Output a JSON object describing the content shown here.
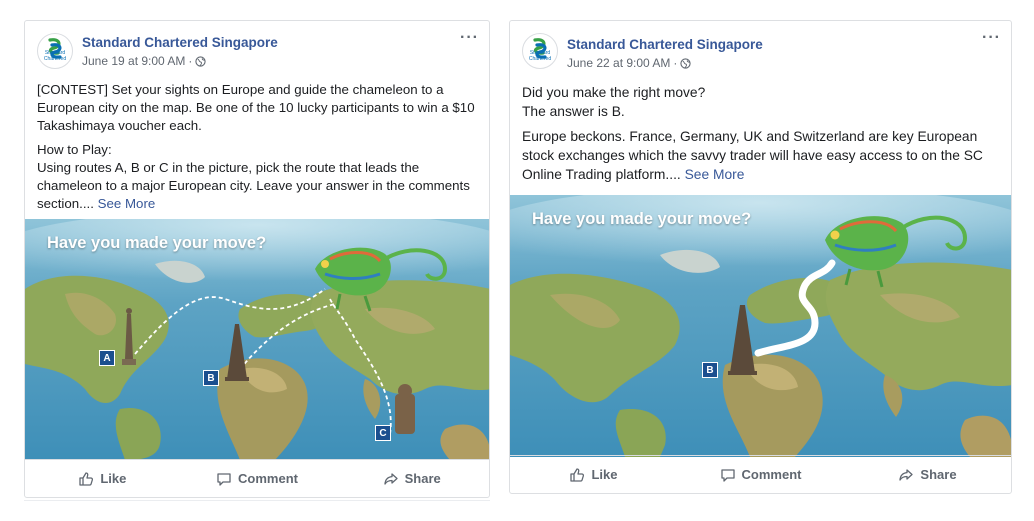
{
  "posts": [
    {
      "page_name": "Standard Chartered Singapore",
      "date": "June 19 at 9:00 AM",
      "separator": "·",
      "paragraphs": [
        "[CONTEST] Set your sights on Europe and guide the chameleon to a European city on the map. Be one of the 10 lucky participants to win a $10 Takashimaya voucher each.",
        "How to Play:",
        "Using routes A, B or C in the picture, pick the route that leads the chameleon to a major European city. Leave your answer in the comments section...."
      ],
      "see_more": "See More",
      "image_title": "Have you made your move?",
      "route_labels": [
        "A",
        "B",
        "C"
      ],
      "actions": {
        "like": "Like",
        "comment": "Comment",
        "share": "Share"
      }
    },
    {
      "page_name": "Standard Chartered Singapore",
      "date": "June 22 at 9:00 AM",
      "separator": "·",
      "paragraphs": [
        "Did you make the right move?",
        "The answer is B.",
        "Europe beckons. France, Germany, UK and Switzerland are key European stock exchanges which the savvy trader will have easy access to on the SC Online Trading platform...."
      ],
      "see_more": "See More",
      "image_title": "Have you made your move?",
      "route_labels": [
        "B"
      ],
      "actions": {
        "like": "Like",
        "comment": "Comment",
        "share": "Share"
      }
    }
  ],
  "logo_text": "Standard Chartered",
  "more_icon": "more-horizontal-icon",
  "privacy_icon": "globe-icon",
  "colors": {
    "page_name": "#385898",
    "meta": "#606770",
    "label_box": "#1b4f8f",
    "ocean": "#6faecb",
    "land": "#8fa85a"
  }
}
